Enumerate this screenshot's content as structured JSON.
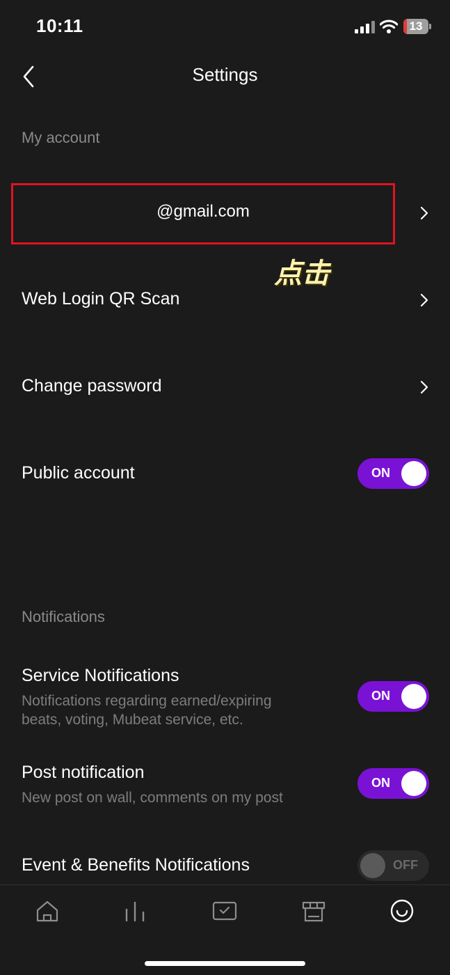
{
  "status_bar": {
    "time": "10:11",
    "battery_level": "13",
    "signal_icon": "cellular-signal-icon",
    "wifi_icon": "wifi-icon"
  },
  "header": {
    "title": "Settings",
    "back_icon": "chevron-left-icon"
  },
  "my_account": {
    "section_label": "My account",
    "email": "@gmail.com",
    "annotation": "点击",
    "rows": [
      {
        "label": "Web Login QR Scan"
      },
      {
        "label": "Change password"
      },
      {
        "label": "Public account",
        "toggle": "ON"
      }
    ]
  },
  "notifications": {
    "section_label": "Notifications",
    "service": {
      "label": "Service Notifications",
      "line1": "Notifications regarding earned/expiring",
      "line2": "beats, voting, Mubeat service, etc.",
      "toggle": "ON"
    },
    "post": {
      "label": "Post notification",
      "description": "New post on wall, comments on my post",
      "toggle": "ON"
    },
    "event": {
      "label": "Event & Benefits Notifications",
      "toggle": "OFF"
    }
  },
  "bottom_nav": {
    "items": [
      "home-icon",
      "chart-icon",
      "vote-icon",
      "store-icon",
      "profile-icon"
    ],
    "active": "profile-icon"
  },
  "colors": {
    "background": "#1b1b1b",
    "accent": "#7a12d6",
    "highlight_border": "#e0141e",
    "annotation": "#fff3b0"
  }
}
